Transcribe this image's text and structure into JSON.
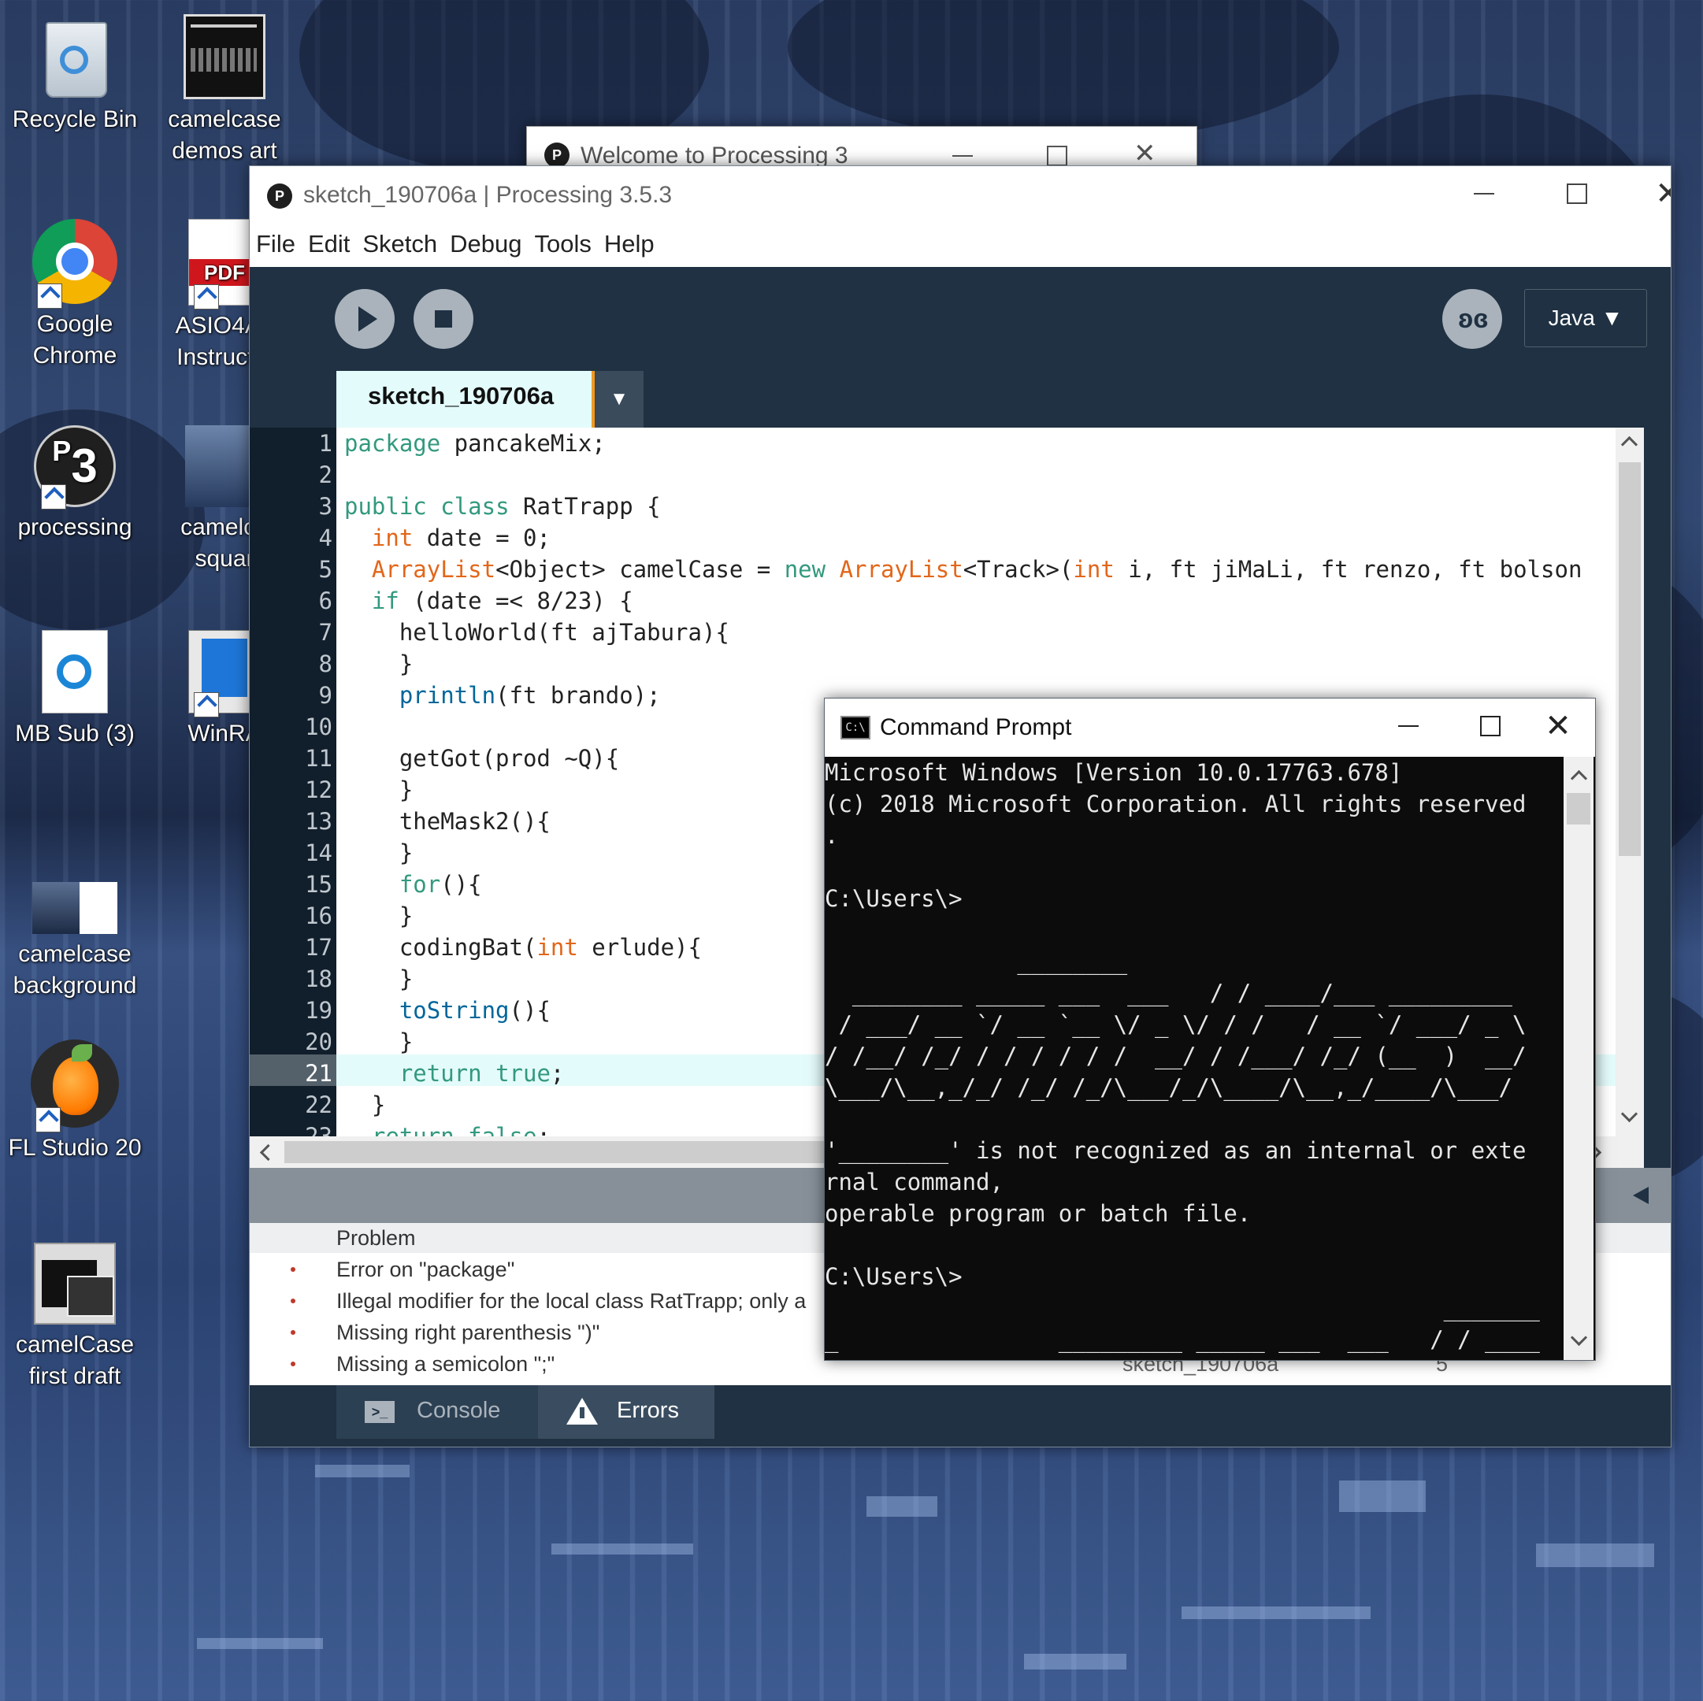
{
  "desktop": {
    "icons": [
      {
        "label1": "Recycle Bin",
        "label2": "",
        "icon": "recycle-bin-icon"
      },
      {
        "label1": "camelcase",
        "label2": "demos art",
        "icon": "file-thumbnail-icon"
      },
      {
        "label1": "Google",
        "label2": "Chrome",
        "icon": "chrome-icon"
      },
      {
        "label1": "ASIO4AL",
        "label2": "Instructio",
        "icon": "pdf-icon"
      },
      {
        "label1": "processing",
        "label2": "",
        "icon": "processing-icon"
      },
      {
        "label1": "camelca",
        "label2": "squar",
        "icon": "image-thumbnail-icon"
      },
      {
        "label1": "MB Sub (3)",
        "label2": "",
        "icon": "document-icon"
      },
      {
        "label1": "WinRA",
        "label2": "",
        "icon": "winrar-icon"
      },
      {
        "label1": "camelcase",
        "label2": "background",
        "icon": "image-thumbnail-icon"
      },
      {
        "label1": "FL Studio 20",
        "label2": "",
        "icon": "fl-studio-icon"
      },
      {
        "label1": "camelCase",
        "label2": "first draft",
        "icon": "image-thumbnail-icon"
      }
    ]
  },
  "welcome_window": {
    "title": "Welcome to Processing 3"
  },
  "processing": {
    "title": "sketch_190706a | Processing 3.5.3",
    "menu": [
      "File",
      "Edit",
      "Sketch",
      "Debug",
      "Tools",
      "Help"
    ],
    "mode": "Java ▼",
    "tab": "sketch_190706a",
    "tab_menu": "▼",
    "code_lines": [
      {
        "n": "1",
        "text": "package pancakeMix;"
      },
      {
        "n": "2",
        "text": ""
      },
      {
        "n": "3",
        "text": "public class RatTrapp {"
      },
      {
        "n": "4",
        "text": "  int date = 0;"
      },
      {
        "n": "5",
        "text": "  ArrayList<Object> camelCase = new ArrayList<Track>(int i, ft jiMaLi, ft renzo, ft bolson"
      },
      {
        "n": "6",
        "text": "  if (date =< 8/23) {"
      },
      {
        "n": "7",
        "text": "    helloWorld(ft ajTabura){"
      },
      {
        "n": "8",
        "text": "    }"
      },
      {
        "n": "9",
        "text": "    println(ft brando);"
      },
      {
        "n": "10",
        "text": ""
      },
      {
        "n": "11",
        "text": "    getGot(prod ~Q){"
      },
      {
        "n": "12",
        "text": "    }"
      },
      {
        "n": "13",
        "text": "    theMask2(){"
      },
      {
        "n": "14",
        "text": "    }"
      },
      {
        "n": "15",
        "text": "    for(){"
      },
      {
        "n": "16",
        "text": "    }"
      },
      {
        "n": "17",
        "text": "    codingBat(int erlude){"
      },
      {
        "n": "18",
        "text": "    }"
      },
      {
        "n": "19",
        "text": "    toString(){"
      },
      {
        "n": "20",
        "text": "    }"
      },
      {
        "n": "21",
        "text": "    return true;"
      },
      {
        "n": "22",
        "text": "  }"
      },
      {
        "n": "23",
        "text": "  return false;"
      }
    ],
    "problems_header": "Problem",
    "problems": [
      "Error on \"package\"",
      "Illegal modifier for the local class RatTrapp; only a",
      "Missing right parenthesis \")\"",
      "Missing a semicolon \";\""
    ],
    "problem_row4_file": "sketch_190706a",
    "problem_row4_line": "5",
    "console_tab": "Console",
    "errors_tab": "Errors"
  },
  "cmd": {
    "title": "Command Prompt",
    "lines": [
      "Microsoft Windows [Version 10.0.17763.678]",
      "(c) 2018 Microsoft Corporation. All rights reserved",
      ".",
      "",
      "C:\\Users\\>",
      "",
      "              ________",
      "  ________ _____ ___  ___   / / ____/___ _________",
      " / ___/ __ `/ __ `__ \\/ _ \\/ / /   / __ `/ ___/ _ \\",
      "/ /__/ /_/ / / / / / /  __/ / /___/ /_/ (__  )  __/",
      "\\___/\\__,_/_/ /_/ /_/\\___/_/\\____/\\__,_/____/\\___/",
      "",
      "'________' is not recognized as an internal or exte",
      "rnal command,",
      "operable program or batch file.",
      "",
      "C:\\Users\\>",
      "                                             _______",
      "_                _________ _____ ___  ___   / / ____",
      "/___ ________   / ___/ __ `/ __ `__ \\/ _ \\/ / /    /",
      "  __ `/ ___/ _ \\/ /__/ /_/ / / / / / /  __/ / /___/"
    ]
  }
}
